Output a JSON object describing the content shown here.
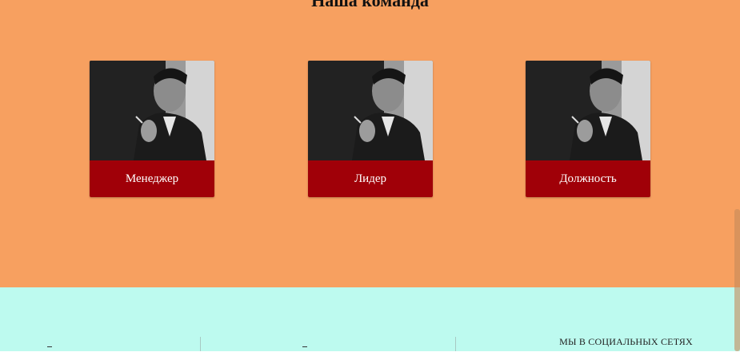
{
  "team": {
    "title": "Наша команда",
    "background_color": "#f7a060",
    "accent_color": "#a00008",
    "members": [
      {
        "role": "Менеджер",
        "photo": "portrait-photo"
      },
      {
        "role": "Лидер",
        "photo": "portrait-photo"
      },
      {
        "role": "Должность",
        "photo": "portrait-photo"
      }
    ]
  },
  "footer": {
    "background_color": "#bdfaef",
    "social_heading": "МЫ В СОЦИАЛЬНЫХ СЕТЯХ"
  }
}
